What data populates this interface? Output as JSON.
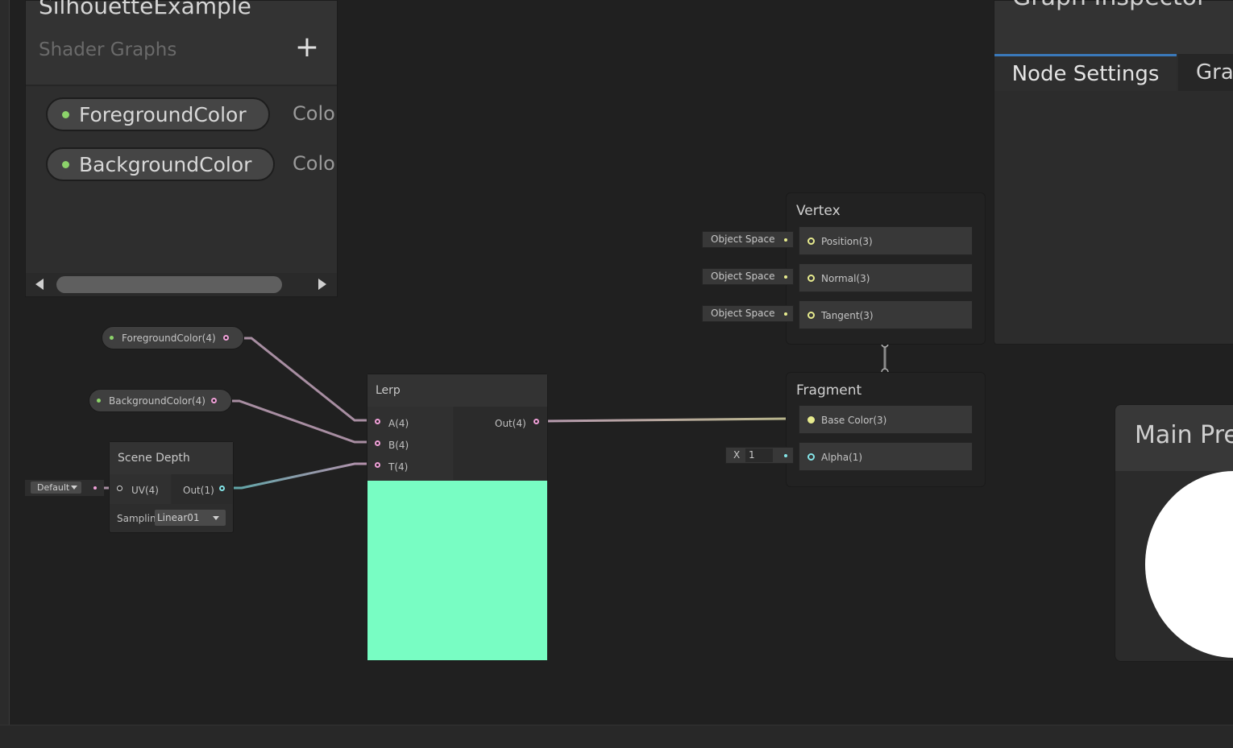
{
  "blackboard": {
    "title": "SilhouetteExample",
    "subtitle": "Shader Graphs",
    "add_icon": "plus-icon",
    "properties": [
      {
        "name": "ForegroundColor",
        "type": "Colo"
      },
      {
        "name": "BackgroundColor",
        "type": "Colo"
      }
    ]
  },
  "inspector": {
    "title": "Graph Inspector",
    "tabs": [
      "Node Settings",
      "Gra"
    ]
  },
  "main_preview": {
    "title": "Main Pre"
  },
  "graph": {
    "property_nodes": [
      {
        "label": "ForegroundColor(4)"
      },
      {
        "label": "BackgroundColor(4)"
      }
    ],
    "scene_depth": {
      "title": "Scene Depth",
      "uv_default": "Default",
      "in_port": "UV(4)",
      "out_port": "Out(1)",
      "sampling_label": "Samplin",
      "sampling_value": "Linear01"
    },
    "lerp": {
      "title": "Lerp",
      "inputs": [
        "A(4)",
        "B(4)",
        "T(4)"
      ],
      "output": "Out(4)",
      "preview_color": "#78fdc3"
    },
    "vertex": {
      "title": "Vertex",
      "slots": [
        {
          "label": "Position(3)",
          "space": "Object Space"
        },
        {
          "label": "Normal(3)",
          "space": "Object Space"
        },
        {
          "label": "Tangent(3)",
          "space": "Object Space"
        }
      ]
    },
    "fragment": {
      "title": "Fragment",
      "slots": [
        {
          "label": "Base Color(3)"
        },
        {
          "label": "Alpha(1)"
        }
      ],
      "alpha_axis": "X",
      "alpha_value": "1"
    }
  },
  "colors": {
    "accent": "#3a79bb",
    "vector4_port": "#f0a0d8",
    "float_port": "#84e4e7",
    "vector3_port": "#e7eb8e",
    "property_dot": "#8cd36a"
  }
}
